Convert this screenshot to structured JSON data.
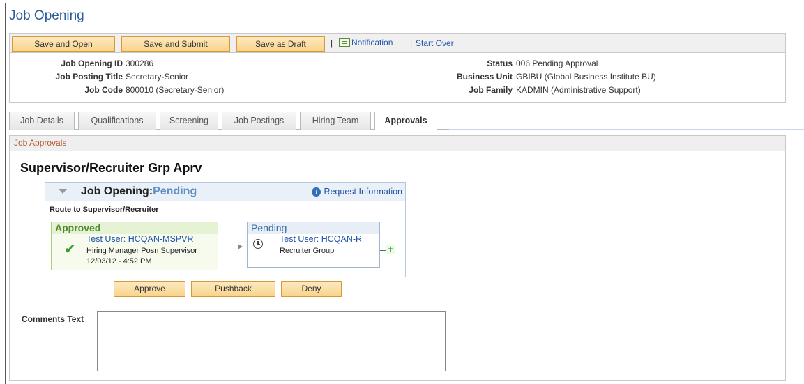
{
  "page": {
    "title": "Job Opening"
  },
  "toolbar": {
    "buttons": [
      "Save and Open",
      "Save and Submit",
      "Save as Draft"
    ],
    "separator": "|",
    "notification_label": "Notification",
    "start_over_label": "Start Over"
  },
  "info": {
    "job_opening_id_label": "Job Opening ID",
    "job_opening_id": "300286",
    "job_posting_title_label": "Job Posting Title",
    "job_posting_title": "Secretary-Senior",
    "job_code_label": "Job Code",
    "job_code": "800010 (Secretary-Senior)",
    "status_label": "Status",
    "status": "006 Pending Approval",
    "business_unit_label": "Business Unit",
    "business_unit": "GBIBU (Global Business Institute BU)",
    "job_family_label": "Job Family",
    "job_family": "KADMIN (Administrative Support)"
  },
  "tabs": [
    "Job Details",
    "Qualifications",
    "Screening",
    "Job Postings",
    "Hiring Team",
    "Approvals"
  ],
  "active_tab": "Approvals",
  "panel": {
    "header": "Job Approvals",
    "section_title": "Supervisor/Recruiter Grp Aprv"
  },
  "workflow": {
    "title_prefix": "Job Opening:",
    "status": "Pending",
    "request_info_label": "Request Information",
    "route_label": "Route to Supervisor/Recruiter",
    "steps": [
      {
        "status": "Approved",
        "user": "Test User: HCQAN-MSPVR",
        "role": "Hiring Manager Posn Supervisor",
        "timestamp": "12/03/12 - 4:52 PM",
        "icon": "checkmark-icon"
      },
      {
        "status": "Pending",
        "user": "Test User: HCQAN-R",
        "role": "Recruiter Group",
        "icon": "clock-icon"
      }
    ],
    "add_symbol": "+"
  },
  "actions": {
    "approve": "Approve",
    "pushback": "Pushback",
    "deny": "Deny"
  },
  "comments": {
    "label": "Comments Text",
    "value": ""
  },
  "colors": {
    "title": "#2a5d9b",
    "button_bg": "#f8d58c",
    "approved_green": "#4e8a2d",
    "link": "#2255aa",
    "panel_header_text": "#b5572a"
  }
}
